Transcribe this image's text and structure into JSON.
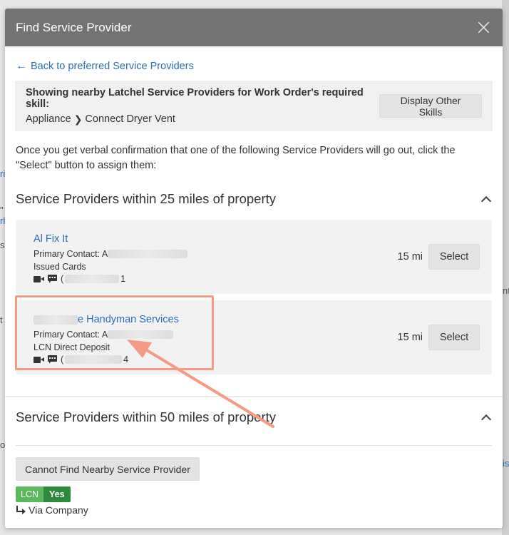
{
  "modal": {
    "title": "Find Service Provider",
    "close_icon": "close-icon",
    "close_glyph": "×"
  },
  "back_link": {
    "arrow": "←",
    "label": "Back to preferred Service Providers"
  },
  "skill": {
    "heading": "Showing nearby Latchel Service Providers for Work Order's required skill:",
    "category": "Appliance",
    "chevron": "❯",
    "subskill": "Connect Dryer Vent",
    "display_button": "Display Other Skills"
  },
  "instructions": "Once you get verbal confirmation that one of the following Service Providers will go out, click the \"Select\" button to assign them:",
  "section_25": {
    "title": "Service Providers within 25 miles of property",
    "providers": [
      {
        "name": "Al Fix It",
        "contact_label": "Primary Contact: A",
        "payment": "Issued Cards",
        "phone_start": "(",
        "phone_end": "1",
        "distance": "15 mi",
        "select": "Select"
      },
      {
        "name_visible": "e Handyman Services",
        "contact_label": "Primary Contact: A",
        "payment": "LCN Direct Deposit",
        "phone_start": "(",
        "phone_end": "4",
        "distance": "15 mi",
        "select": "Select"
      }
    ]
  },
  "section_50": {
    "title": "Service Providers within 50 miles of property"
  },
  "footer": {
    "cannot_find_button": "Cannot Find Nearby Service Provider",
    "lcn_label": "LCN",
    "lcn_value": "Yes",
    "via": "Via Company"
  },
  "colors": {
    "header_bg": "#737373",
    "link": "#2d6db5",
    "annotation": "#f59a85",
    "lcn_green": "#5cb85c",
    "yes_green": "#2e8b3e"
  },
  "background_fragments": [
    "ri",
    "\" /",
    "rl",
    "s",
    "t",
    "or",
    "nt",
    "is"
  ]
}
